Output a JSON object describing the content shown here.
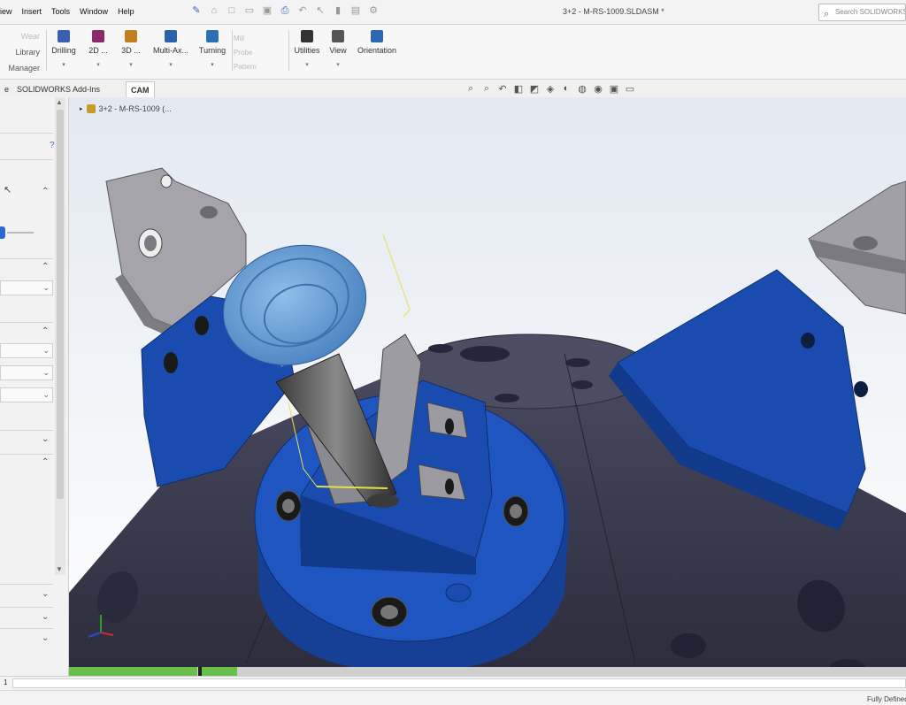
{
  "menu": {
    "items": [
      "iew",
      "Insert",
      "Tools",
      "Window",
      "Help"
    ]
  },
  "document_title": "3+2 - M-RS-1009.SLDASM *",
  "search": {
    "placeholder": "Search SOLIDWORKS"
  },
  "ribbon": {
    "left_items": [
      "Wear",
      "Library",
      "Manager"
    ],
    "buttons": [
      {
        "label": "Drilling",
        "icon": "drilling-icon",
        "color": "#3a5fb0"
      },
      {
        "label": "2D ...",
        "icon": "2d-icon",
        "color": "#8a2a6a"
      },
      {
        "label": "3D ...",
        "icon": "3d-icon",
        "color": "#c08020"
      },
      {
        "label": "Multi-Ax...",
        "icon": "multi-axis-icon",
        "color": "#2a62a8"
      },
      {
        "label": "Turning",
        "icon": "turning-icon",
        "color": "#2a70b8"
      },
      {
        "label": "Utilities",
        "icon": "utilities-icon",
        "color": "#333333"
      },
      {
        "label": "View",
        "icon": "view-icon",
        "color": "#555555"
      },
      {
        "label": "Orientation",
        "icon": "orientation-icon",
        "color": "#2a6ab0"
      }
    ],
    "disabled_items": [
      "Mill",
      "Probe",
      "Pattern"
    ]
  },
  "tabs": [
    {
      "label": "e"
    },
    {
      "label": "SOLIDWORKS Add-Ins"
    },
    {
      "label": "CAM"
    }
  ],
  "tree": {
    "label": "3+2 - M-RS-1009 (..."
  },
  "status": {
    "page": "1",
    "rebuild_state": "Fully Defined"
  },
  "colors": {
    "fixture_blue": "#1a4cb0",
    "fixture_dark_blue": "#123a8a",
    "housing": "#3a3a52",
    "tool": "#6aa0d8",
    "bracket": "#9a9aa0",
    "accent_yellow": "#e8e04a"
  }
}
